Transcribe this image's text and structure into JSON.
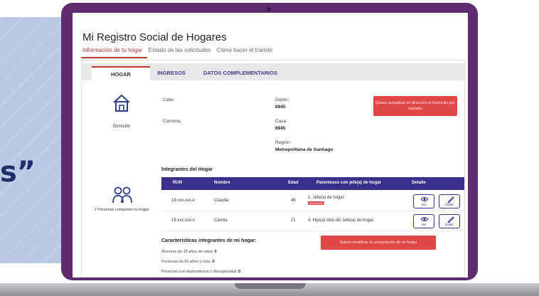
{
  "backdrop": {
    "quote_fragment": "s”"
  },
  "page": {
    "title": "Mi Registro Social de Hogares",
    "top_tabs": [
      "Información de tu hogar",
      "Estado de las solicitudes",
      "Cómo hacer el trámite"
    ],
    "subtabs": [
      "HOGAR",
      "INGRESOS",
      "DATOS COMPLEMENTARIOS"
    ]
  },
  "domicilio": {
    "label": "Domicilio",
    "calle_label": "Calle:",
    "comuna_label": "Comuna:",
    "depto_label": "Depto:",
    "depto_value": "8945",
    "casa_label": "Casa:",
    "casa_value": "8945",
    "region_label": "Región:",
    "region_value": "Metropolitana de Santiago",
    "update_button": "Quiero actualizar mi dirección el Domicilio por traslado"
  },
  "integrantes": {
    "side_label": "2 Personas componen tu hogar",
    "title": "Integrantes del Hogar",
    "columns": [
      "RUN",
      "Nombre",
      "Edad",
      "Parentesco con jefe(a) de hogar",
      "Detalle"
    ],
    "rows": [
      {
        "run": "19.xxx.xxx-x",
        "nombre": "Claudia",
        "edad": "46",
        "parentesco": "1. Jefe(a) de hogar",
        "badge": "Informante"
      },
      {
        "run": "19.xxx.xxx-x",
        "nombre": "Camila",
        "edad": "21",
        "parentesco": "4. Hijo(a) sólo del Jefe(a) de hogar",
        "badge": ""
      }
    ],
    "ver_label": "Ver",
    "editar_label": "Editar"
  },
  "caracteristicas": {
    "title": "Características integrantes de mi hogar:",
    "lines": [
      {
        "label": "Menores de 18 años de edad:",
        "value": "0"
      },
      {
        "label": "Personas de 60 años o más:",
        "value": "0"
      },
      {
        "label": "Personas con dependencia o discapacidad:",
        "value": "0"
      }
    ],
    "modify_button": "Quiero modificar la composición de mi hogar"
  },
  "colors": {
    "lid": "#5e2c6e",
    "accent_red": "#e04848",
    "table_head": "#3b2f8c",
    "backdrop_blue": "#b9c9e4"
  }
}
